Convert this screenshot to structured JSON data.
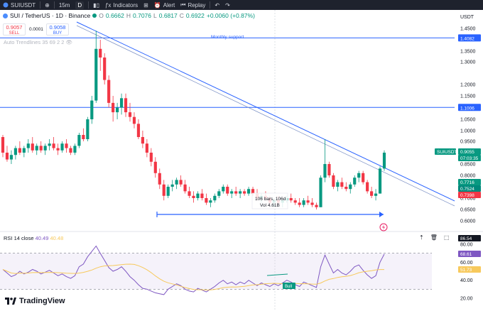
{
  "toolbar": {
    "symbol": "SUIUSDT",
    "interval": "15m",
    "interval_active": "D",
    "indicators_label": "Indicators",
    "alert_label": "Alert",
    "replay_label": "Replay"
  },
  "legend": {
    "title": "SUI / TetherUS · 1D · Binance",
    "open_label": "O",
    "open": "0.6662",
    "high_label": "H",
    "high": "0.7076",
    "low_label": "L",
    "low": "0.6817",
    "close_label": "C",
    "close": "0.6922",
    "change": "+0.0060 (+0.87%)"
  },
  "trade": {
    "sell_price": "0.9057",
    "sell_label": "SELL",
    "spread": "0.0001",
    "buy_price": "0.9058",
    "buy_label": "BUY"
  },
  "indicator_label": "Auto Trendlines 35 69 2 2",
  "currency_label": "USDT",
  "price_axis": {
    "ticks": [
      "1.4500",
      "1.3500",
      "1.3000",
      "1.2000",
      "1.1500",
      "1.0500",
      "1.0000",
      "0.9500",
      "0.8500",
      "0.8000",
      "0.7500",
      "0.7000",
      "0.6500",
      "0.6000"
    ],
    "ticks_values": [
      1.45,
      1.35,
      1.3,
      1.2,
      1.15,
      1.05,
      1.0,
      0.95,
      0.85,
      0.8,
      0.75,
      0.7,
      0.65,
      0.6
    ]
  },
  "labels": {
    "monthly_support": "Monthly support",
    "level_1": "1.4082",
    "level_2": "1.1006",
    "last_symbol": "SUIUSDT",
    "last_price": "0.9055",
    "countdown": "07:03:35",
    "tag_green": "0.7716",
    "tag_teal": "0.7524",
    "tag_red": "0.7398",
    "measure_bars": "106 bars, 106d",
    "measure_vol": "Vol 4.61B"
  },
  "rsi": {
    "label": "RSI 14 close",
    "value": "40.49",
    "ma_value": "40.48",
    "axis": [
      "80.00",
      "60.00",
      "40.00",
      "20.00"
    ],
    "axis_values": [
      80,
      60,
      40,
      20
    ],
    "tag_top": "86.54",
    "tag_rsi": "68.61",
    "tag_ma": "51.73",
    "bull_label": "Bull"
  },
  "footer": {
    "brand": "TradingView"
  },
  "colors": {
    "up": "#089981",
    "down": "#f23645",
    "line_blue": "#2962ff",
    "rsi": "#7e57c2",
    "rsi_ma": "#f7c95c"
  },
  "chart_data": {
    "type": "candlestick",
    "symbol": "SUI / TetherUS",
    "ohlc": [
      [
        0.97,
        0.98,
        0.88,
        0.9
      ],
      [
        0.9,
        0.93,
        0.86,
        0.87
      ],
      [
        0.87,
        0.91,
        0.85,
        0.89
      ],
      [
        0.89,
        0.93,
        0.87,
        0.92
      ],
      [
        0.92,
        0.95,
        0.89,
        0.9
      ],
      [
        0.9,
        0.93,
        0.88,
        0.92
      ],
      [
        0.92,
        0.96,
        0.9,
        0.94
      ],
      [
        0.94,
        0.97,
        0.9,
        0.91
      ],
      [
        0.91,
        0.94,
        0.89,
        0.93
      ],
      [
        0.93,
        0.95,
        0.9,
        0.91
      ],
      [
        0.91,
        0.94,
        0.89,
        0.93
      ],
      [
        0.93,
        0.96,
        0.91,
        0.94
      ],
      [
        0.94,
        0.97,
        0.91,
        0.92
      ],
      [
        0.92,
        0.94,
        0.89,
        0.91
      ],
      [
        0.91,
        0.95,
        0.9,
        0.94
      ],
      [
        0.94,
        0.96,
        0.9,
        0.92
      ],
      [
        0.92,
        0.93,
        0.89,
        0.9
      ],
      [
        0.9,
        0.94,
        0.89,
        0.93
      ],
      [
        0.93,
        0.99,
        0.92,
        0.98
      ],
      [
        0.98,
        1.01,
        0.95,
        0.96
      ],
      [
        0.96,
        1.06,
        0.95,
        1.05
      ],
      [
        1.05,
        1.15,
        1.03,
        1.13
      ],
      [
        1.13,
        1.44,
        1.12,
        1.36
      ],
      [
        1.36,
        1.4,
        1.26,
        1.32
      ],
      [
        1.32,
        1.34,
        1.2,
        1.22
      ],
      [
        1.22,
        1.24,
        1.1,
        1.12
      ],
      [
        1.12,
        1.15,
        1.04,
        1.08
      ],
      [
        1.08,
        1.12,
        1.05,
        1.1
      ],
      [
        1.1,
        1.16,
        1.07,
        1.14
      ],
      [
        1.14,
        1.16,
        1.06,
        1.08
      ],
      [
        1.08,
        1.12,
        1.04,
        1.06
      ],
      [
        1.06,
        1.08,
        1.01,
        1.03
      ],
      [
        1.03,
        1.05,
        0.96,
        0.97
      ],
      [
        0.97,
        1.0,
        0.92,
        0.94
      ],
      [
        0.94,
        0.96,
        0.88,
        0.9
      ],
      [
        0.9,
        0.92,
        0.84,
        0.86
      ],
      [
        0.86,
        0.88,
        0.79,
        0.81
      ],
      [
        0.81,
        0.83,
        0.74,
        0.76
      ],
      [
        0.76,
        0.78,
        0.69,
        0.71
      ],
      [
        0.71,
        0.76,
        0.7,
        0.75
      ],
      [
        0.75,
        0.78,
        0.73,
        0.76
      ],
      [
        0.76,
        0.79,
        0.74,
        0.78
      ],
      [
        0.78,
        0.8,
        0.75,
        0.76
      ],
      [
        0.76,
        0.78,
        0.72,
        0.73
      ],
      [
        0.73,
        0.75,
        0.7,
        0.71
      ],
      [
        0.71,
        0.73,
        0.68,
        0.7
      ],
      [
        0.7,
        0.73,
        0.69,
        0.72
      ],
      [
        0.72,
        0.74,
        0.69,
        0.7
      ],
      [
        0.7,
        0.72,
        0.67,
        0.68
      ],
      [
        0.68,
        0.7,
        0.66,
        0.69
      ],
      [
        0.69,
        0.72,
        0.68,
        0.71
      ],
      [
        0.71,
        0.74,
        0.7,
        0.73
      ],
      [
        0.73,
        0.76,
        0.72,
        0.75
      ],
      [
        0.75,
        0.76,
        0.71,
        0.72
      ],
      [
        0.72,
        0.74,
        0.7,
        0.73
      ],
      [
        0.73,
        0.75,
        0.71,
        0.72
      ],
      [
        0.72,
        0.74,
        0.7,
        0.73
      ],
      [
        0.73,
        0.74,
        0.71,
        0.72
      ],
      [
        0.72,
        0.75,
        0.71,
        0.74
      ],
      [
        0.74,
        0.75,
        0.71,
        0.72
      ],
      [
        0.72,
        0.74,
        0.69,
        0.7
      ],
      [
        0.7,
        0.72,
        0.68,
        0.71
      ],
      [
        0.71,
        0.73,
        0.69,
        0.7
      ],
      [
        0.7,
        0.71,
        0.67,
        0.68
      ],
      [
        0.68,
        0.7,
        0.66,
        0.69
      ],
      [
        0.69,
        0.71,
        0.67,
        0.68
      ],
      [
        0.68,
        0.7,
        0.66,
        0.69
      ],
      [
        0.69,
        0.71,
        0.68,
        0.7
      ],
      [
        0.7,
        0.72,
        0.68,
        0.69
      ],
      [
        0.69,
        0.7,
        0.67,
        0.68
      ],
      [
        0.68,
        0.7,
        0.66,
        0.67
      ],
      [
        0.67,
        0.7,
        0.66,
        0.69
      ],
      [
        0.69,
        0.71,
        0.67,
        0.68
      ],
      [
        0.68,
        0.7,
        0.66,
        0.67
      ],
      [
        0.67,
        0.68,
        0.65,
        0.66
      ],
      [
        0.66,
        0.8,
        0.66,
        0.79
      ],
      [
        0.79,
        0.96,
        0.77,
        0.85
      ],
      [
        0.85,
        0.86,
        0.79,
        0.8
      ],
      [
        0.8,
        0.81,
        0.74,
        0.75
      ],
      [
        0.75,
        0.78,
        0.73,
        0.77
      ],
      [
        0.77,
        0.79,
        0.74,
        0.75
      ],
      [
        0.75,
        0.77,
        0.73,
        0.74
      ],
      [
        0.74,
        0.77,
        0.72,
        0.76
      ],
      [
        0.76,
        0.8,
        0.75,
        0.79
      ],
      [
        0.79,
        0.82,
        0.77,
        0.81
      ],
      [
        0.81,
        0.82,
        0.76,
        0.77
      ],
      [
        0.77,
        0.78,
        0.72,
        0.73
      ],
      [
        0.73,
        0.75,
        0.7,
        0.71
      ],
      [
        0.71,
        0.74,
        0.69,
        0.72
      ],
      [
        0.72,
        0.84,
        0.72,
        0.83
      ],
      [
        0.83,
        0.91,
        0.82,
        0.9
      ]
    ],
    "hlines": [
      1.4082,
      1.1006
    ],
    "rsi_values": [
      52,
      48,
      44,
      46,
      50,
      47,
      49,
      52,
      50,
      47,
      49,
      51,
      48,
      45,
      47,
      44,
      42,
      45,
      55,
      58,
      66,
      72,
      78,
      70,
      62,
      54,
      50,
      52,
      55,
      50,
      44,
      40,
      35,
      31,
      30,
      28,
      26,
      25,
      24,
      30,
      33,
      36,
      34,
      30,
      28,
      27,
      31,
      29,
      27,
      30,
      33,
      37,
      40,
      36,
      38,
      35,
      38,
      36,
      40,
      37,
      34,
      37,
      35,
      33,
      36,
      34,
      37,
      40,
      38,
      35,
      33,
      38,
      36,
      34,
      32,
      55,
      68,
      58,
      48,
      52,
      48,
      46,
      50,
      55,
      57,
      51,
      46,
      42,
      45,
      60,
      69
    ]
  }
}
